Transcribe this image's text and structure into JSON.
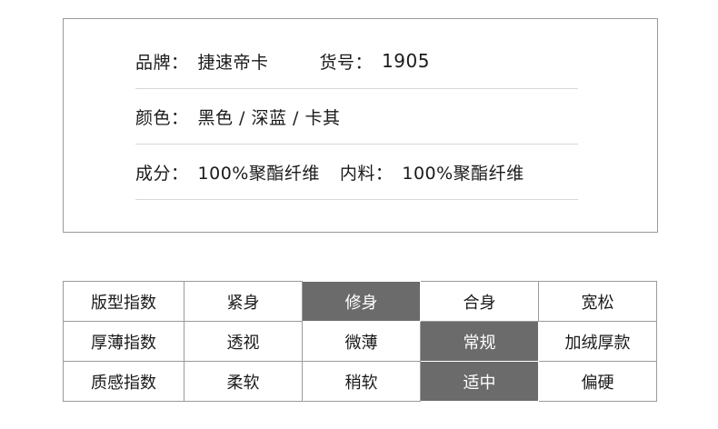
{
  "info": {
    "brand_label": "品牌：",
    "brand_value": "捷速帝卡",
    "sku_label": "货号：",
    "sku_value": "1905",
    "color_label": "颜色：",
    "color_value": "黑色 / 深蓝 / 卡其",
    "material_label": "成分：",
    "material_value": "100%聚酯纤维",
    "lining_label": "内料：",
    "lining_value": "100%聚酯纤维"
  },
  "grid": {
    "rows": [
      {
        "title": "版型指数",
        "options": [
          "紧身",
          "修身",
          "合身",
          "宽松"
        ],
        "selected": 1
      },
      {
        "title": "厚薄指数",
        "options": [
          "透视",
          "微薄",
          "常规",
          "加绒厚款"
        ],
        "selected": 2
      },
      {
        "title": "质感指数",
        "options": [
          "柔软",
          "稍软",
          "适中",
          "偏硬"
        ],
        "selected": 2
      }
    ],
    "selected_color": "#6b6b6b"
  }
}
